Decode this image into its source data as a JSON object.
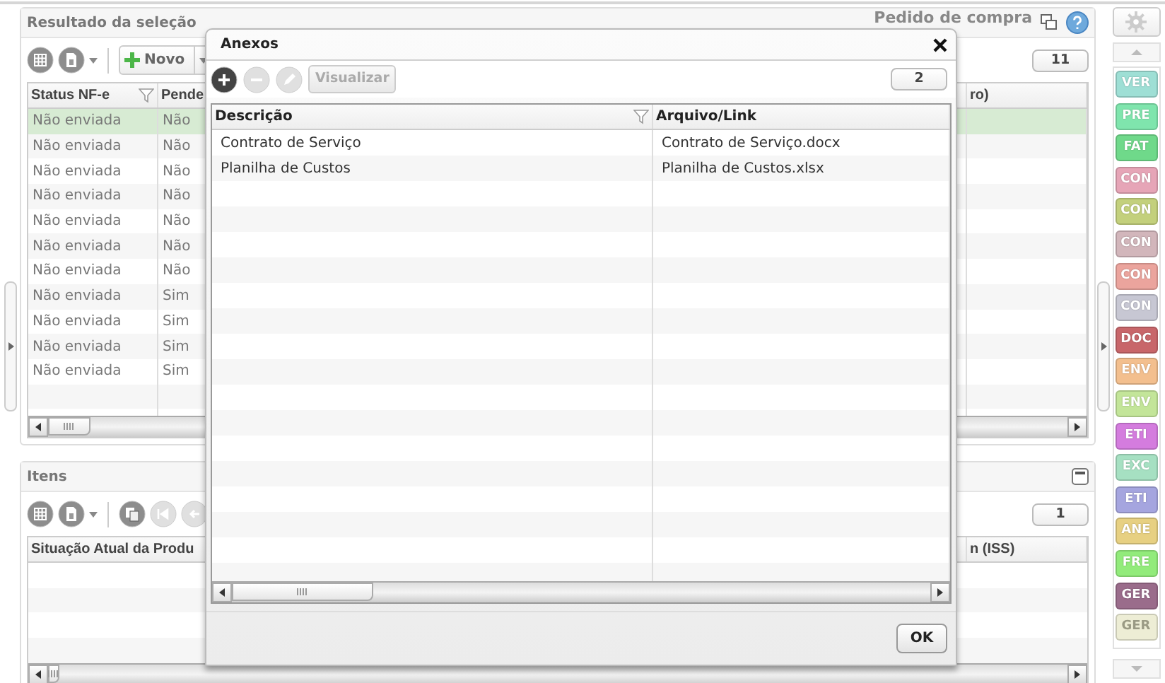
{
  "main_panel": {
    "title": "Resultado da seleção",
    "context": "Pedido de compra",
    "new_button": "Novo",
    "count": "11",
    "table": {
      "columns": [
        {
          "label": "Status NF-e",
          "filter": true
        },
        {
          "label": "Pende",
          "filter": false
        },
        {
          "label": "ro)",
          "filter": false
        }
      ],
      "rows": [
        {
          "cells": [
            "Não enviada",
            "Não"
          ],
          "selected": true
        },
        {
          "cells": [
            "Não enviada",
            "Não"
          ],
          "selected": false
        },
        {
          "cells": [
            "Não enviada",
            "Não"
          ],
          "selected": false
        },
        {
          "cells": [
            "Não enviada",
            "Não"
          ],
          "selected": false
        },
        {
          "cells": [
            "Não enviada",
            "Não"
          ],
          "selected": false
        },
        {
          "cells": [
            "Não enviada",
            "Não"
          ],
          "selected": false
        },
        {
          "cells": [
            "Não enviada",
            "Não"
          ],
          "selected": false
        },
        {
          "cells": [
            "Não enviada",
            "Sim"
          ],
          "selected": false
        },
        {
          "cells": [
            "Não enviada",
            "Sim"
          ],
          "selected": false
        },
        {
          "cells": [
            "Não enviada",
            "Sim"
          ],
          "selected": false
        },
        {
          "cells": [
            "Não enviada",
            "Sim"
          ],
          "selected": false
        }
      ]
    }
  },
  "items_panel": {
    "title": "Itens",
    "count": "1",
    "columns": [
      "Situação Atual da Produ",
      "n (ISS)"
    ]
  },
  "dialog": {
    "title": "Anexos",
    "toolbar": [
      {
        "kind": "add",
        "disabled": false
      },
      {
        "kind": "remove",
        "disabled": true
      },
      {
        "kind": "edit",
        "disabled": true
      },
      {
        "kind": "button",
        "label": "Visualizar",
        "disabled": true
      }
    ],
    "count": "2",
    "table": {
      "columns": [
        {
          "label": "Descrição",
          "filter": true
        },
        {
          "label": "Arquivo/Link",
          "filter": false
        }
      ],
      "rows": [
        [
          "Contrato de Serviço",
          "Contrato de Serviço.docx"
        ],
        [
          "Planilha de Custos",
          "Planilha de Custos.xlsx"
        ]
      ]
    },
    "ok_button": "OK"
  },
  "sidebar": {
    "tags": [
      {
        "label": "VER",
        "color": "#9edfd5"
      },
      {
        "label": "PRE",
        "color": "#7fe5ad"
      },
      {
        "label": "FAT",
        "color": "#6fd98a"
      },
      {
        "label": "CON",
        "color": "#e6a5b7"
      },
      {
        "label": "CON",
        "color": "#c3d07c"
      },
      {
        "label": "CON",
        "color": "#d2b6bb"
      },
      {
        "label": "CON",
        "color": "#eba49d"
      },
      {
        "label": "CON",
        "color": "#c7c7d3"
      },
      {
        "label": "DOC",
        "color": "#c8666a"
      },
      {
        "label": "ENV",
        "color": "#f3bf8e"
      },
      {
        "label": "ENV",
        "color": "#c3e599"
      },
      {
        "label": "ETI",
        "color": "#d47cde"
      },
      {
        "label": "EXC",
        "color": "#a6e0c2"
      },
      {
        "label": "ETI",
        "color": "#a5a5df"
      },
      {
        "label": "ANE",
        "color": "#e7d082"
      },
      {
        "label": "FRE",
        "color": "#92eb7b"
      },
      {
        "label": "GER",
        "color": "#9a6c8b"
      },
      {
        "label": "GER",
        "color": "#ededd5"
      }
    ]
  }
}
